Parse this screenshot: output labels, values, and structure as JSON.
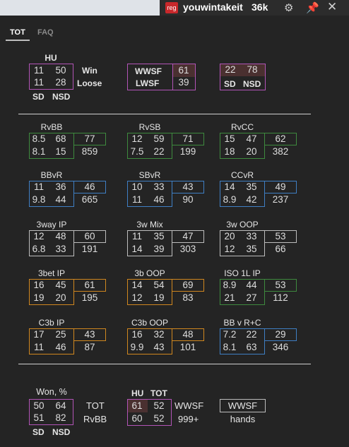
{
  "window": {
    "reg_badge": "reg",
    "player": "youwintakeit",
    "hands_count": "36k",
    "gear_icon": "gear-icon",
    "pin_icon": "pin-icon",
    "close_icon": "close-icon"
  },
  "tabs": [
    {
      "label": "TOT",
      "active": true
    },
    {
      "label": "FAQ",
      "active": false
    }
  ],
  "hu": {
    "title": "HU",
    "cells": [
      "11",
      "50",
      "11",
      "28"
    ],
    "row_labels": [
      "Win",
      "Loose"
    ],
    "col_labels": [
      "SD",
      "NSD"
    ]
  },
  "wwsf_box": {
    "labels": [
      "WWSF",
      "LWSF"
    ],
    "values": [
      "61",
      "39"
    ]
  },
  "sd_box": {
    "values": [
      "22",
      "78"
    ],
    "labels": [
      "SD",
      "NSD"
    ]
  },
  "grid": [
    {
      "title": "RvBB",
      "color": "green",
      "left": [
        "8.5",
        "68",
        "8.1",
        "15"
      ],
      "right": [
        "77",
        "859"
      ]
    },
    {
      "title": "RvSB",
      "color": "green",
      "left": [
        "12",
        "59",
        "7.5",
        "22"
      ],
      "right": [
        "71",
        "199"
      ]
    },
    {
      "title": "RvCC",
      "color": "green",
      "left": [
        "15",
        "47",
        "18",
        "20"
      ],
      "right": [
        "62",
        "382"
      ]
    },
    {
      "title": "BBvR",
      "color": "blue",
      "left": [
        "11",
        "36",
        "9.8",
        "44"
      ],
      "right": [
        "46",
        "665"
      ]
    },
    {
      "title": "SBvR",
      "color": "blue",
      "left": [
        "10",
        "33",
        "11",
        "46"
      ],
      "right": [
        "43",
        "90"
      ]
    },
    {
      "title": "CCvR",
      "color": "blue",
      "left": [
        "14",
        "35",
        "8.9",
        "42"
      ],
      "right": [
        "49",
        "237"
      ]
    },
    {
      "title": "3way IP",
      "color": "gray",
      "left": [
        "12",
        "48",
        "6.8",
        "33"
      ],
      "right": [
        "60",
        "191"
      ]
    },
    {
      "title": "3w Mix",
      "color": "gray",
      "left": [
        "11",
        "35",
        "14",
        "39"
      ],
      "right": [
        "47",
        "303"
      ]
    },
    {
      "title": "3w OOP",
      "color": "gray",
      "left": [
        "20",
        "33",
        "12",
        "35"
      ],
      "right": [
        "53",
        "66"
      ]
    },
    {
      "title": "3bet IP",
      "color": "orange",
      "left": [
        "16",
        "45",
        "19",
        "20"
      ],
      "right": [
        "61",
        "195"
      ]
    },
    {
      "title": "3b OOP",
      "color": "orange",
      "left": [
        "14",
        "54",
        "12",
        "19"
      ],
      "right": [
        "69",
        "83"
      ]
    },
    {
      "title": "ISO 1L IP",
      "color": "green",
      "left": [
        "8.9",
        "44",
        "21",
        "27"
      ],
      "right": [
        "53",
        "112"
      ]
    },
    {
      "title": "C3b IP",
      "color": "orange",
      "left": [
        "17",
        "25",
        "11",
        "46"
      ],
      "right": [
        "43",
        "87"
      ]
    },
    {
      "title": "C3b OOP",
      "color": "orange",
      "left": [
        "16",
        "32",
        "9.9",
        "43"
      ],
      "right": [
        "48",
        "101"
      ]
    },
    {
      "title": "BB v R+C",
      "color": "blue",
      "left": [
        "7.2",
        "22",
        "8.1",
        "63"
      ],
      "right": [
        "29",
        "346"
      ]
    }
  ],
  "won": {
    "title": "Won, %",
    "cells": [
      "50",
      "64",
      "51",
      "82"
    ],
    "row_labels": [
      "TOT",
      "RvBB"
    ],
    "col_labels": [
      "SD",
      "NSD"
    ]
  },
  "hu_tot": {
    "col_labels": [
      "HU",
      "TOT"
    ],
    "cells": [
      "61",
      "52",
      "60",
      "52"
    ],
    "row_labels": [
      "WWSF",
      "999+"
    ]
  },
  "wwsf_hands": {
    "box_label": "WWSF",
    "sub_label": "hands"
  },
  "colors": {
    "purple": "#b254b7",
    "green": "#3e8a3e",
    "blue": "#3f7fc4",
    "gray": "#bdbdbd",
    "orange": "#d0871f",
    "reg": "#c8282b",
    "pin": "#f0c419"
  }
}
